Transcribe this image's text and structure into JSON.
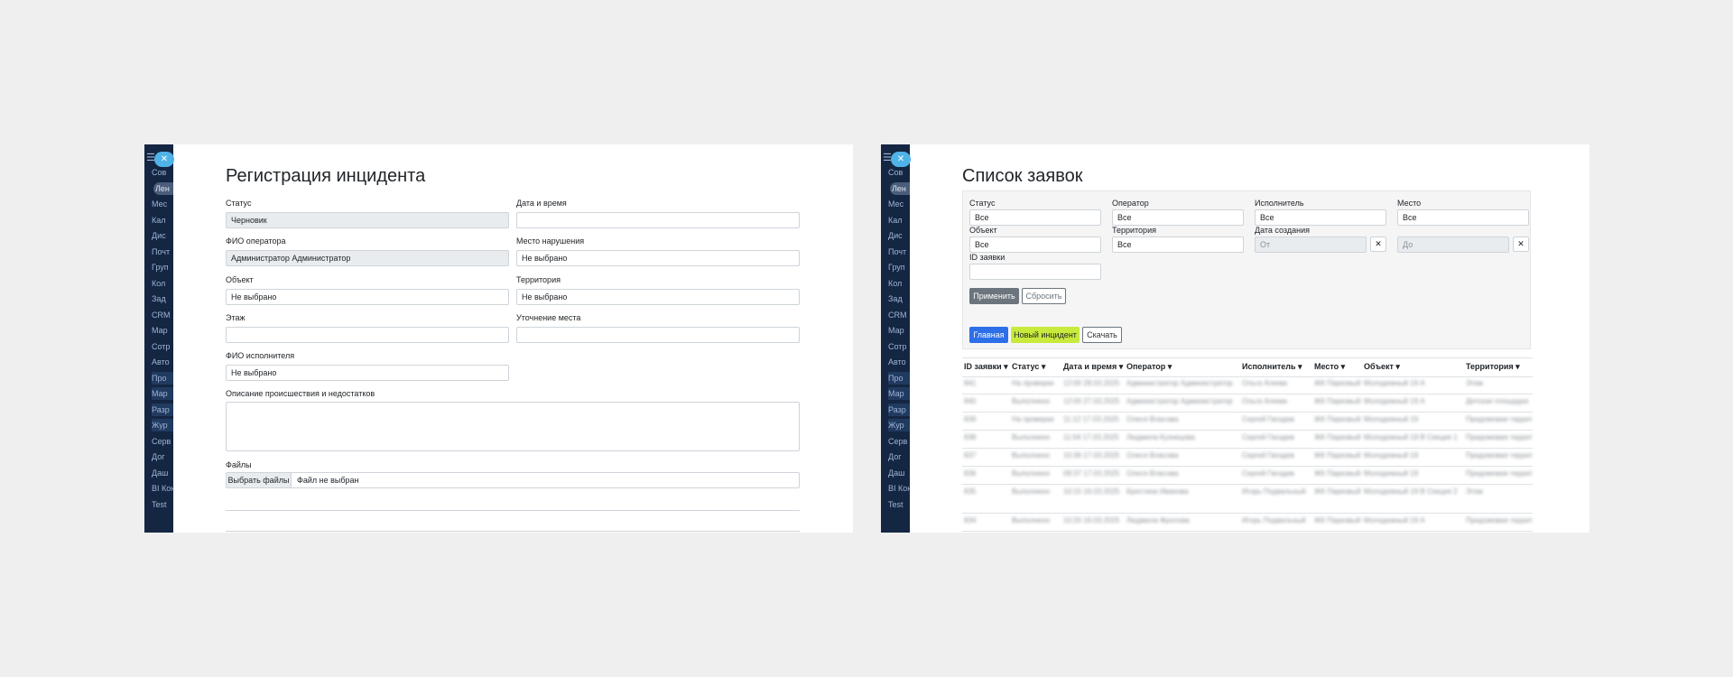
{
  "left": {
    "sidebar": {
      "items": [
        "Сов",
        "Лен",
        "Мес",
        "Кал",
        "Дис",
        "Почт",
        "Груп",
        "Кол",
        "Зад",
        "CRM",
        "Мар",
        "Сотр",
        "Авто",
        "Про",
        "Мар",
        "Разр",
        "Жур",
        "Серв",
        "Дог",
        "Даш",
        "BI Кон",
        "Test"
      ]
    },
    "title": "Регистрация инцидента",
    "fields": {
      "status": {
        "label": "Статус",
        "value": "Черновик"
      },
      "datetime": {
        "label": "Дата и время",
        "value": ""
      },
      "operator": {
        "label": "ФИО оператора",
        "value": "Администратор Администратор"
      },
      "violation_place": {
        "label": "Место нарушения",
        "value": "Не выбрано"
      },
      "object": {
        "label": "Объект",
        "value": "Не выбрано"
      },
      "territory": {
        "label": "Территория",
        "value": "Не выбрано"
      },
      "floor": {
        "label": "Этаж",
        "value": ""
      },
      "place_detail": {
        "label": "Уточнение места",
        "value": ""
      },
      "executor": {
        "label": "ФИО исполнителя",
        "value": "Не выбрано"
      },
      "description": {
        "label": "Описание происшествия и недостатков",
        "value": ""
      },
      "files": {
        "label": "Файлы",
        "button": "Выбрать файлы",
        "status": "Файл не выбран"
      }
    }
  },
  "right": {
    "sidebar": {
      "items": [
        "Сов",
        "Лен",
        "Мес",
        "Кал",
        "Дис",
        "Почт",
        "Груп",
        "Кол",
        "Зад",
        "CRM",
        "Мар",
        "Сотр",
        "Авто",
        "Про",
        "Мар",
        "Разр",
        "Жур",
        "Серв",
        "Дог",
        "Даш",
        "BI Кон",
        "Test"
      ]
    },
    "title": "Список заявок",
    "filters": {
      "status": {
        "label": "Статус",
        "value": "Все"
      },
      "operator": {
        "label": "Оператор",
        "value": "Все"
      },
      "executor": {
        "label": "Исполнитель",
        "value": "Все"
      },
      "place": {
        "label": "Место",
        "value": "Все"
      },
      "object": {
        "label": "Объект",
        "value": "Все"
      },
      "territory": {
        "label": "Территория",
        "value": "Все"
      },
      "created": {
        "label": "Дата создания",
        "from": "От",
        "to": "До",
        "clear": "✕"
      },
      "request_id": {
        "label": "ID заявки",
        "value": ""
      }
    },
    "buttons": {
      "apply": "Применить",
      "reset": "Сбросить",
      "home": "Главная",
      "new_incident": "Новый инцидент",
      "download": "Скачать"
    },
    "table": {
      "headers": [
        "ID заявки ▾",
        "Статус ▾",
        "Дата и время ▾",
        "Оператор ▾",
        "Исполнитель ▾",
        "Место ▾",
        "Объект ▾",
        "Территория ▾"
      ],
      "rows": [
        [
          "841",
          "На проверке",
          "12:00 28.03.2025",
          "Администратор Администратор",
          "Ольга Агеева",
          "ЖК Парковый",
          "Молодежный 19 А",
          "Этаж"
        ],
        [
          "840",
          "Выполнено",
          "12:00 27.03.2025",
          "Администратор Администратор",
          "Ольга Агеева",
          "ЖК Парковый",
          "Молодежный 19 А",
          "Детская площадка"
        ],
        [
          "839",
          "На проверке",
          "11:12 17.03.2025",
          "Олеся Власова",
          "Сергей Гвоздев",
          "ЖК Парковый",
          "Молодежный 19",
          "Придомовая территория"
        ],
        [
          "838",
          "Выполнено",
          "11:04 17.03.2025",
          "Людмила Кузнецова",
          "Сергей Гвоздев",
          "ЖК Парковый",
          "Молодежный 19 В Секция 1",
          "Придомовая территория"
        ],
        [
          "837",
          "Выполнено",
          "10:36 17.03.2025",
          "Олеся Власова",
          "Сергей Гвоздев",
          "ЖК Парковый",
          "Молодежный 19",
          "Придомовая территория"
        ],
        [
          "836",
          "Выполнено",
          "09:37 17.03.2025",
          "Олеся Власова",
          "Сергей Гвоздев",
          "ЖК Парковый",
          "Молодежный 19",
          "Придомовая территория"
        ],
        [
          "835",
          "Выполнено",
          "10:15 16.03.2025",
          "Кристина Иванова",
          "Игорь Подвальный",
          "ЖК Парковый",
          "Молодежный 19 В Секция 2",
          "Этаж"
        ],
        [
          "834",
          "Выполнено",
          "10:20 16.03.2025",
          "Людмила Фролова",
          "Игорь Подвальный",
          "ЖК Парковый",
          "Молодежный 19 А",
          "Придомовая территория"
        ]
      ]
    }
  },
  "colors": {
    "background": "#efeff0",
    "sidebar": "#152642",
    "close_button": "#4fb3e8",
    "primary": "#2d6fe8",
    "accent_new": "#c8ea3c",
    "secondary": "#6c757d"
  }
}
